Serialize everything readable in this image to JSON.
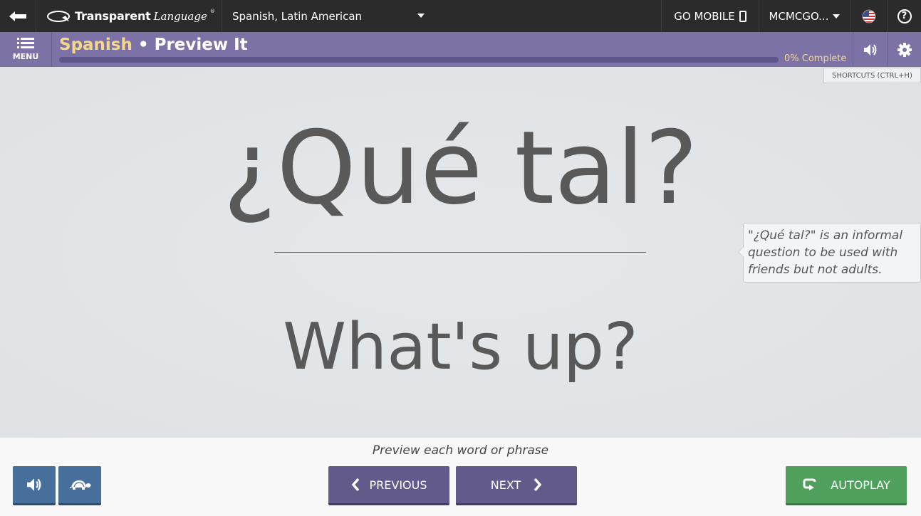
{
  "topbar": {
    "back_icon": "back-arrow-icon",
    "logo_bold": "Transparent",
    "logo_italic": "Language",
    "logo_reg": "®",
    "language_selector": "Spanish, Latin American",
    "go_mobile": "GO MOBILE",
    "user": "MCMCGO...",
    "flag_icon": "us-flag-icon",
    "help": "?"
  },
  "header": {
    "menu_label": "MENU",
    "title_language": "Spanish",
    "title_separator": " • ",
    "title_activity": "Preview It",
    "progress_fraction": 0,
    "progress_label": "0% Complete",
    "colors": {
      "header_bg": "#7c72a6",
      "accent": "#f5d78a"
    }
  },
  "shortcuts_hint": "SHORTCUTS (CTRL+H)",
  "card": {
    "word": "¿Qué tal?",
    "translation": "What's up?",
    "note": "\"¿Qué tal?\" is an informal question to be used with friends but not adults."
  },
  "footer": {
    "instruction": "Preview each word or phrase",
    "previous_label": "PREVIOUS",
    "next_label": "NEXT",
    "autoplay_label": "AUTOPLAY",
    "colors": {
      "blue": "#466f9c",
      "purple": "#625a8a",
      "green": "#4fa05c"
    }
  }
}
